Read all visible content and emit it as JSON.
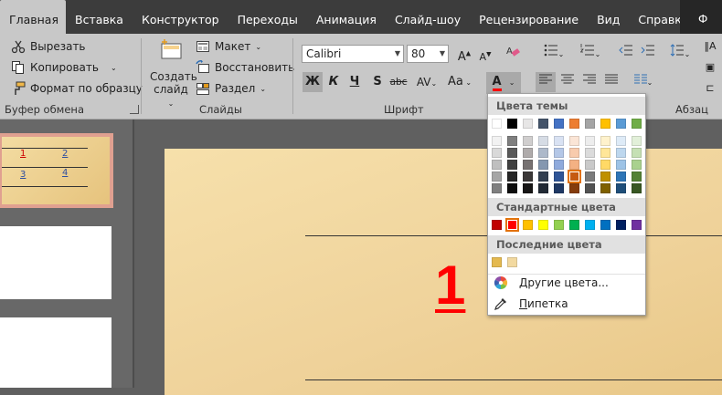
{
  "tabs": [
    {
      "label": "Главная",
      "active": true
    },
    {
      "label": "Вставка"
    },
    {
      "label": "Конструктор"
    },
    {
      "label": "Переходы"
    },
    {
      "label": "Анимация"
    },
    {
      "label": "Слайд-шоу"
    },
    {
      "label": "Рецензирование"
    },
    {
      "label": "Вид"
    },
    {
      "label": "Справка"
    },
    {
      "label": "Ф"
    }
  ],
  "clipboard": {
    "cut": "Вырезать",
    "copy": "Копировать",
    "format_painter": "Формат по образцу",
    "group_label": "Буфер обмена"
  },
  "slides_group": {
    "new_slide_line1": "Создать",
    "new_slide_line2": "слайд",
    "layout": "Макет",
    "reset": "Восстановить",
    "section": "Раздел",
    "group_label": "Слайды"
  },
  "font_group": {
    "font_name": "Calibri",
    "font_size": "80",
    "bold": "Ж",
    "italic": "К",
    "underline": "Ч",
    "shadow": "S",
    "strike": "abc",
    "spacing": "AV",
    "case": "Aa",
    "font_color_letter": "A",
    "group_label": "Шрифт"
  },
  "paragraph_group": {
    "group_label": "Абзац"
  },
  "thumbnail": {
    "cells": [
      "1",
      "2",
      "3",
      "4"
    ]
  },
  "slide": {
    "big_number": "1"
  },
  "color_popup": {
    "theme_header": "Цвета темы",
    "standard_header": "Стандартные цвета",
    "recent_header": "Последние цвета",
    "more_colors": "Другие цвета...",
    "more_colors_accel": "Д",
    "more_colors_rest": "ругие цвета...",
    "eyedropper_accel": "П",
    "eyedropper_rest": "ипетка",
    "theme_top": [
      "#FFFFFF",
      "#000000",
      "#E7E6E6",
      "#44546A",
      "#4472C4",
      "#ED7D31",
      "#A5A5A5",
      "#FFC000",
      "#5B9BD5",
      "#70AD47"
    ],
    "theme_shades": [
      [
        "#F2F2F2",
        "#7F7F7F",
        "#D0CECE",
        "#D6DCE5",
        "#D9E2F3",
        "#FBE5D6",
        "#EDEDED",
        "#FFF2CC",
        "#DEEBF7",
        "#E2F0D9"
      ],
      [
        "#D9D9D9",
        "#595959",
        "#AFABAB",
        "#ADB9CA",
        "#B4C7E7",
        "#F8CBAD",
        "#DBDBDB",
        "#FFE699",
        "#BDD7EE",
        "#C5E0B4"
      ],
      [
        "#BFBFBF",
        "#404040",
        "#767171",
        "#8497B0",
        "#8FAADC",
        "#F4B183",
        "#C9C9C9",
        "#FFD966",
        "#9DC3E6",
        "#A9D18E"
      ],
      [
        "#A6A6A6",
        "#262626",
        "#3B3838",
        "#333F50",
        "#2F5597",
        "#C55A11",
        "#7B7B7B",
        "#BF9000",
        "#2E75B6",
        "#538135"
      ],
      [
        "#808080",
        "#0D0D0D",
        "#171616",
        "#222A35",
        "#1F3864",
        "#843C0C",
        "#525252",
        "#7F6000",
        "#1F4E79",
        "#385723"
      ]
    ],
    "standard": [
      "#C00000",
      "#FF0000",
      "#FFC000",
      "#FFFF00",
      "#92D050",
      "#00B050",
      "#00B0F0",
      "#0070C0",
      "#002060",
      "#7030A0"
    ],
    "recent": [
      "#E4B94F",
      "#F2D9A0"
    ],
    "selected_theme": {
      "row": 3,
      "col": 5
    },
    "selected_standard": 1
  }
}
